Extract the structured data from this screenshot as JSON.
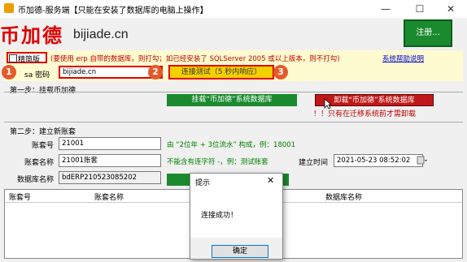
{
  "window": {
    "title": "币加德-服务端【只能在安装了数据库的电脑上操作】",
    "minimize": "—",
    "maximize": "☐",
    "close": "✕"
  },
  "header": {
    "logo_text": "币加德",
    "logo_url": "bijiade.cn",
    "register_label": "注册..."
  },
  "config": {
    "checkbox_label": "精简版",
    "note": "(要使用 erp 自带的数据库，则打勾；如已经安装了 SQLServer 2005 或以上版本，则不打勾)",
    "help_link": "系统帮助说明",
    "sa_label": "sa 密码",
    "sa_value": "bijiade.cn",
    "test_button": "连接测试（5 秒内响应）",
    "badges": [
      "1",
      "2",
      "3"
    ]
  },
  "step1": {
    "title": "第一步：挂载币加德",
    "mount_button": "挂载“币加德”系统数据库",
    "unmount_button": "卸载“币加德”系统数据库",
    "migrate_note": "！！只有在迁移系统前才需卸载"
  },
  "step2": {
    "title": "第二步：建立新账套",
    "account_no_label": "账套号",
    "account_no_value": "21001",
    "account_no_hint": "由 “2位年 + 3位流水” 构成，例：18001",
    "account_name_label": "账套名称",
    "account_name_value": "21001账套",
    "account_name_hint": "不能含有连字符 -，例：测试账套",
    "create_time_label": "建立时间",
    "create_time_value": "2021-05-23 08:52:02",
    "db_name_label": "数据库名称",
    "db_name_value": "bdERP210523085202"
  },
  "grid": {
    "columns": [
      "账套号",
      "账套名称",
      "数据库名称"
    ]
  },
  "dialog": {
    "title": "提示",
    "message": "连接成功！",
    "ok_button": "确定"
  }
}
